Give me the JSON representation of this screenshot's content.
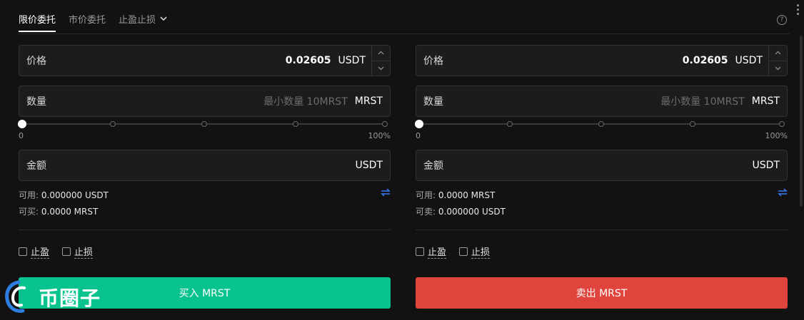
{
  "tabs": [
    {
      "label": "限价委托",
      "active": true
    },
    {
      "label": "市价委托",
      "active": false
    },
    {
      "label": "止盈止损",
      "active": false
    }
  ],
  "help_icon": "?",
  "icons": {
    "help": "question-circle-icon",
    "more": "vertical-dots-icon",
    "swap": "swap-arrows-icon",
    "step_up": "chevron-up-icon",
    "step_down": "chevron-down-icon",
    "tab_dropdown": "chevron-down-icon"
  },
  "colors": {
    "buy": "#08c38e",
    "sell": "#e0453d",
    "accent": "#3b7bf6",
    "background": "#121212"
  },
  "buy": {
    "price_label": "价格",
    "price_value": "0.02605",
    "price_unit": "USDT",
    "qty_label": "数量",
    "qty_placeholder": "最小数量 10MRST",
    "qty_unit": "MRST",
    "slider_min": "0",
    "slider_max": "100%",
    "slider_value": 0,
    "amount_label": "金额",
    "amount_unit": "USDT",
    "avail_label": "可用:",
    "avail_value": "0.000000 USDT",
    "can_label": "可买:",
    "can_value": "0.0000 MRST",
    "tp_label": "止盈",
    "sl_label": "止损",
    "button": "买入 MRST"
  },
  "sell": {
    "price_label": "价格",
    "price_value": "0.02605",
    "price_unit": "USDT",
    "qty_label": "数量",
    "qty_placeholder": "最小数量 10MRST",
    "qty_unit": "MRST",
    "slider_min": "0",
    "slider_max": "100%",
    "slider_value": 0,
    "amount_label": "金额",
    "amount_unit": "USDT",
    "avail_label": "可用:",
    "avail_value": "0.0000 MRST",
    "can_label": "可卖:",
    "can_value": "0.000000 USDT",
    "tp_label": "止盈",
    "sl_label": "止损",
    "button": "卖出 MRST"
  },
  "watermark": "币圈子"
}
